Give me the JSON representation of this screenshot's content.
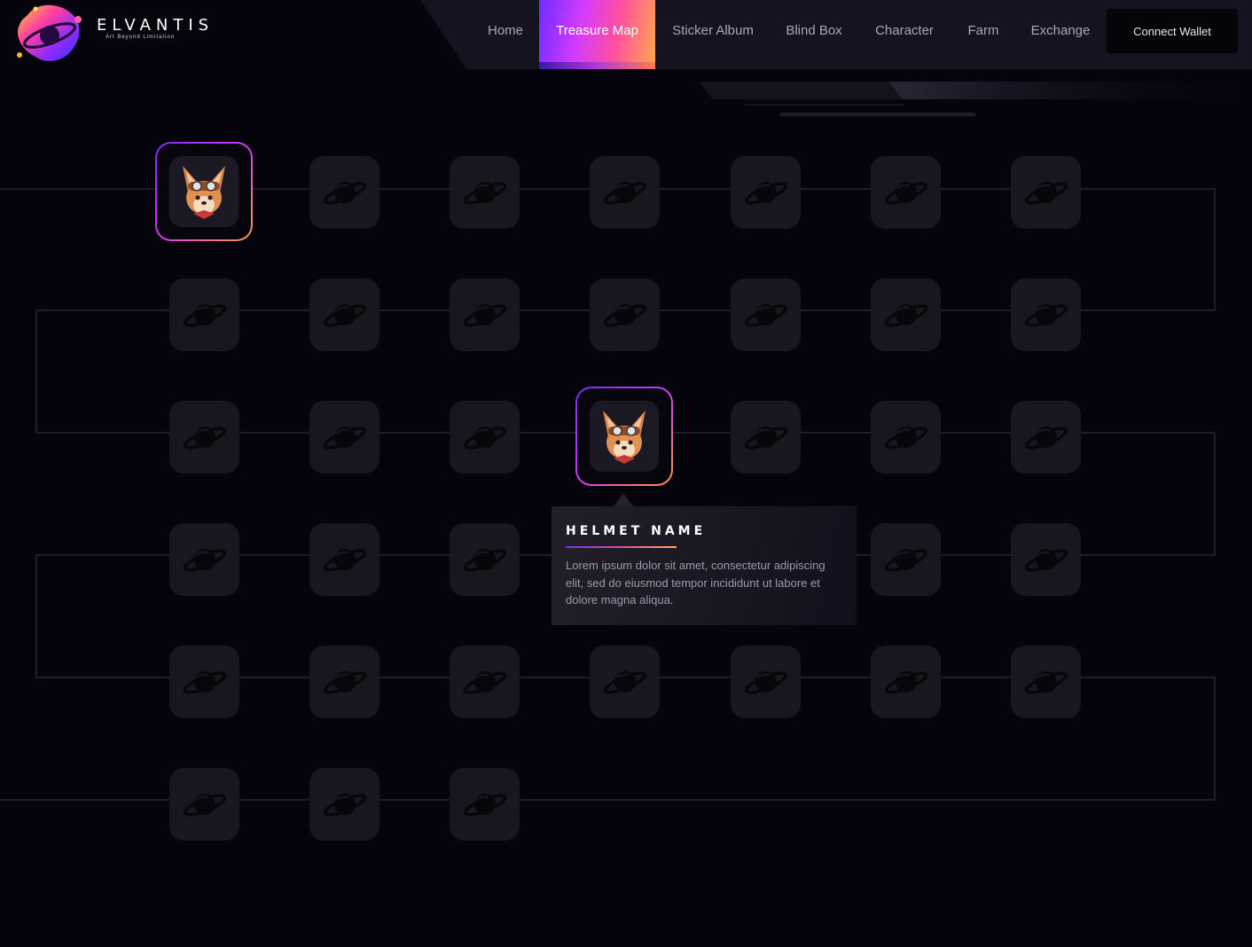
{
  "brand": {
    "name": "ELVANTIS",
    "tagline": "Art Beyond Limitation"
  },
  "nav": {
    "items": [
      {
        "label": "Home",
        "active": false
      },
      {
        "label": "Treasure Map",
        "active": true
      },
      {
        "label": "Sticker Album",
        "active": false
      },
      {
        "label": "Blind Box",
        "active": false
      },
      {
        "label": "Character",
        "active": false
      },
      {
        "label": "Farm",
        "active": false
      },
      {
        "label": "Exchange",
        "active": false
      }
    ],
    "connect_label": "Connect Wallet"
  },
  "map": {
    "rows": [
      [
        "unlocked",
        "locked",
        "locked",
        "locked",
        "locked",
        "locked",
        "locked"
      ],
      [
        "locked",
        "locked",
        "locked",
        "locked",
        "locked",
        "locked",
        "locked"
      ],
      [
        "locked",
        "locked",
        "locked",
        "unlocked",
        "locked",
        "locked",
        "locked"
      ],
      [
        "locked",
        "locked",
        "locked",
        "locked",
        "locked",
        "locked",
        "locked"
      ],
      [
        "locked",
        "locked",
        "locked",
        "locked",
        "locked",
        "locked",
        "locked"
      ],
      [
        "locked",
        "locked",
        "locked"
      ]
    ],
    "locked_icon": "planet-icon",
    "unlocked_icon": "fox-helmet-icon"
  },
  "tooltip": {
    "title": "HELMET NAME",
    "description": "Lorem ipsum dolor sit amet, consectetur adipiscing elit, sed do eiusmod tempor incididunt ut labore et dolore magna aliqua."
  },
  "colors": {
    "background": "#05040d",
    "tile": "#18161f",
    "accent_start": "#6f2bff",
    "accent_mid": "#d33bff",
    "accent_end": "#ffa94d"
  }
}
